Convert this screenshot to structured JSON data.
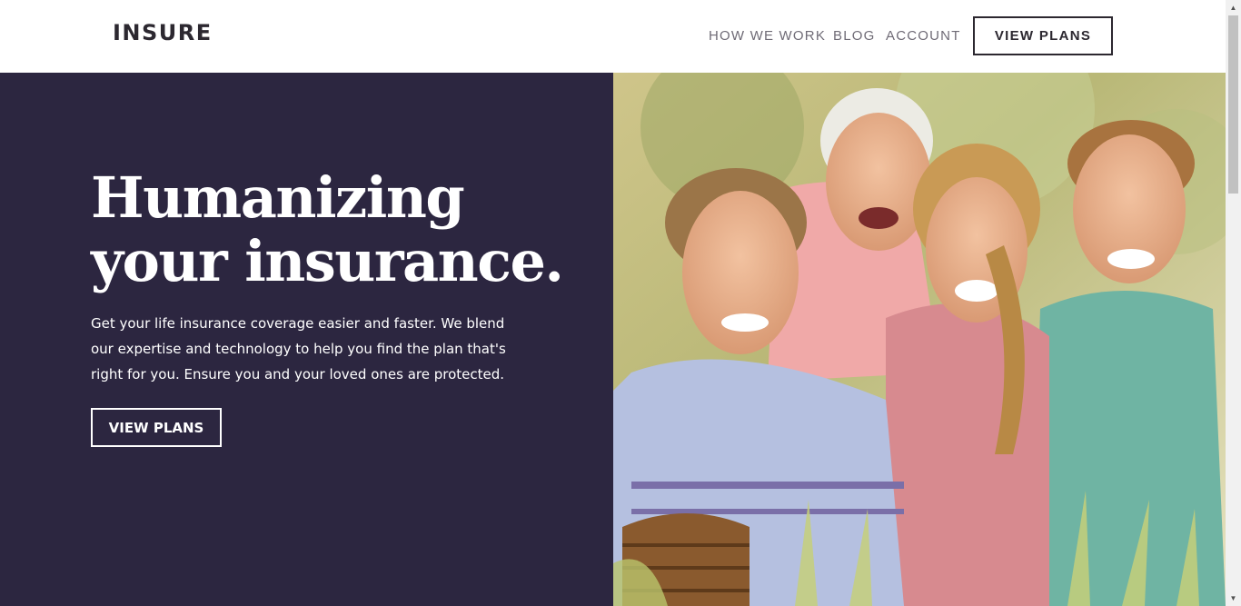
{
  "header": {
    "logo": "INSURE",
    "nav": [
      {
        "label": "HOW WE WORK"
      },
      {
        "label": "BLOG"
      },
      {
        "label": "ACCOUNT"
      }
    ],
    "cta_label": "VIEW PLANS"
  },
  "hero": {
    "title_line1": "Humanizing",
    "title_line2": "your insurance.",
    "description": "Get your life insurance coverage easier and faster. We blend our expertise and technology to help you find the plan that's right for you. Ensure you and your loved ones are protected.",
    "cta_label": "VIEW PLANS",
    "photo_icon": "family-photo"
  },
  "colors": {
    "hero_bg": "#2c2640",
    "text_dark": "#2c2830",
    "nav_text": "#6f6b76"
  }
}
